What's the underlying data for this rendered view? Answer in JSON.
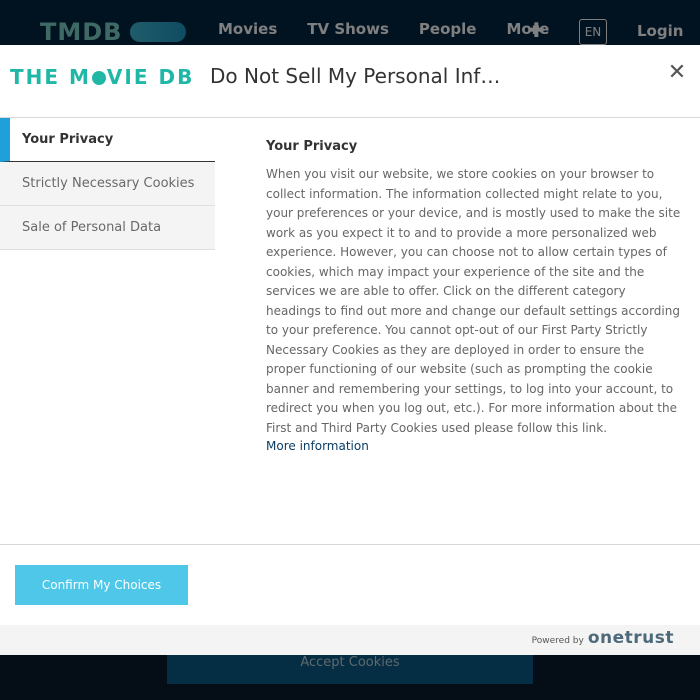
{
  "site": {
    "logo_text": "TMDB",
    "nav": [
      "Movies",
      "TV Shows",
      "People",
      "More"
    ],
    "plus_glyph": "✚",
    "language": "EN",
    "login": "Login",
    "accept_cookies": "Accept Cookies"
  },
  "modal": {
    "brand_logo": {
      "part1": "THE M",
      "part2": "VIE DB"
    },
    "title": "Do Not Sell My Personal Information",
    "close_glyph": "✕",
    "tabs": [
      {
        "label": "Your Privacy",
        "active": true
      },
      {
        "label": "Strictly Necessary Cookies",
        "active": false
      },
      {
        "label": "Sale of Personal Data",
        "active": false
      }
    ],
    "content": {
      "heading": "Your Privacy",
      "body": "When you visit our website, we store cookies on your browser to collect information. The information collected might relate to you, your preferences or your device, and is mostly used to make the site work as you expect it to and to provide a more personalized web experience. However, you can choose not to allow certain types of cookies, which may impact your experience of the site and the services we are able to offer. Click on the different category headings to find out more and change our default settings according to your preference. You cannot opt-out of our First Party Strictly Necessary Cookies as they are deployed in order to ensure the proper functioning of our website (such as prompting the cookie banner and remembering your settings, to log into your account, to redirect you when you log out, etc.). For more information about the First and Third Party Cookies used please follow this link.",
      "more_link": "More information"
    },
    "confirm_button": "Confirm My Choices",
    "powered_by": "Powered by",
    "onetrust": "onetrust"
  },
  "colors": {
    "accent": "#1fa0da",
    "confirm_bg": "#4ec7e9",
    "brand_teal": "#21b7a7",
    "site_header": "#032541"
  }
}
